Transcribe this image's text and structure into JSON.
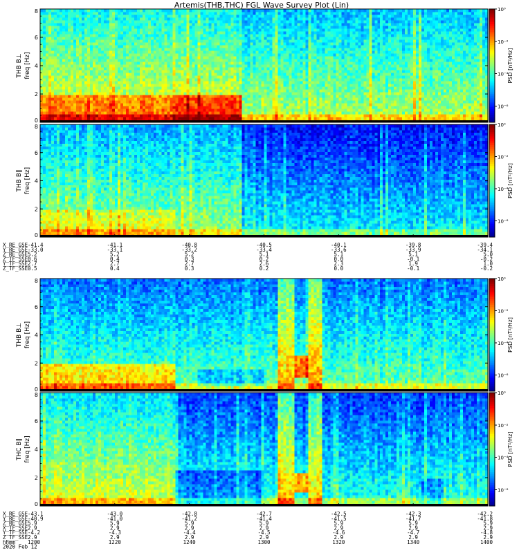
{
  "title": "Artemis(THB,THC) FGL Wave Survey Plot (Lin)",
  "chart_data": [
    {
      "type": "heatmap",
      "panel": "THB B⊥",
      "ylabel": "freq [Hz]",
      "label": "THB B⊥",
      "ylim": [
        0,
        8
      ],
      "yticks": [
        "0",
        "2",
        "4",
        "6",
        "8"
      ],
      "colorbar_label": "PSD [nT²/Hz]",
      "colorbar_ticks": [
        "10⁰",
        "10⁻²",
        "10⁻⁴",
        "10⁻⁶"
      ],
      "colorbar_top_exp": 0,
      "colorbar_bottom_exp": -7,
      "seed": 11,
      "base": -3.1,
      "features": [
        {
          "x0": 0.0,
          "x1": 0.3,
          "f0": 0,
          "f1": 2,
          "level": 1.6
        },
        {
          "x0": 0.3,
          "x1": 0.45,
          "f0": 0,
          "f1": 2,
          "level": 2.1
        },
        {
          "x0": 0.0,
          "x1": 0.45,
          "f0": 2,
          "f1": 8,
          "level": 0.5
        }
      ]
    },
    {
      "type": "heatmap",
      "panel": "THB B∥",
      "ylabel": "freq [Hz]",
      "label": "THB B∥",
      "ylim": [
        0,
        8
      ],
      "yticks": [
        "0",
        "2",
        "4",
        "6",
        "8"
      ],
      "colorbar_label": "PSD [nT²/Hz]",
      "colorbar_ticks": [
        "10⁰",
        "10⁻²",
        "10⁻⁴",
        "10⁻⁶"
      ],
      "colorbar_top_exp": 0,
      "colorbar_bottom_exp": -7,
      "seed": 23,
      "base": -4.3,
      "features": [
        {
          "x0": 0.0,
          "x1": 0.45,
          "f0": 0,
          "f1": 8,
          "level": 1.1
        },
        {
          "x0": 0.0,
          "x1": 0.3,
          "f0": 0,
          "f1": 2,
          "level": 0.6
        }
      ]
    },
    {
      "type": "heatmap",
      "panel": "THB B⊥",
      "ylabel": "freq [Hz]",
      "label": "THB B⊥",
      "ylim": [
        0,
        8
      ],
      "yticks": [
        "0",
        "2",
        "4",
        "6",
        "8"
      ],
      "colorbar_label": "PSD [nT²/Hz]",
      "colorbar_ticks": [
        "10⁰",
        "10⁻²",
        "10⁻⁴",
        "10⁻⁶"
      ],
      "colorbar_top_exp": 0,
      "colorbar_bottom_exp": -7,
      "seed": 37,
      "base": -3.6,
      "features": [
        {
          "x0": 0.0,
          "x1": 0.3,
          "f0": 0,
          "f1": 2,
          "level": 1.4
        },
        {
          "x0": 0.53,
          "x1": 0.57,
          "f0": 0,
          "f1": 8,
          "level": 1.6
        },
        {
          "x0": 0.57,
          "x1": 0.6,
          "f0": 1,
          "f1": 2.6,
          "level": 2.3
        },
        {
          "x0": 0.6,
          "x1": 0.63,
          "f0": 0,
          "f1": 8,
          "level": 1.6
        },
        {
          "x0": 0.35,
          "x1": 0.5,
          "f0": 0.3,
          "f1": 1.5,
          "level": -0.9
        }
      ]
    },
    {
      "type": "heatmap",
      "panel": "THC B∥",
      "ylabel": "freq [Hz]",
      "label": "THC B∥",
      "ylim": [
        0,
        8
      ],
      "yticks": [
        "0",
        "2",
        "4",
        "6",
        "8"
      ],
      "colorbar_label": "PSD [nT²/Hz]",
      "colorbar_ticks": [
        "10⁰",
        "10⁻²",
        "10⁻⁴",
        "10⁻⁶"
      ],
      "colorbar_top_exp": 0,
      "colorbar_bottom_exp": -7,
      "seed": 53,
      "base": -4.0,
      "features": [
        {
          "x0": 0.0,
          "x1": 0.3,
          "f0": 0,
          "f1": 8,
          "level": 1.2
        },
        {
          "x0": 0.53,
          "x1": 0.57,
          "f0": 0,
          "f1": 8,
          "level": 1.8
        },
        {
          "x0": 0.57,
          "x1": 0.6,
          "f0": 1,
          "f1": 2.4,
          "level": 2.3
        },
        {
          "x0": 0.6,
          "x1": 0.63,
          "f0": 0,
          "f1": 8,
          "level": 1.7
        },
        {
          "x0": 0.3,
          "x1": 0.5,
          "f0": 0,
          "f1": 2.5,
          "level": -1.0
        },
        {
          "x0": 0.85,
          "x1": 0.9,
          "f0": 0,
          "f1": 2,
          "level": -0.8
        }
      ]
    }
  ],
  "ephem_top": {
    "rows": [
      {
        "label": "X_RE_GSE",
        "values": [
          "-41.4",
          "-41.1",
          "-40.8",
          "-40.5",
          "-40.1",
          "-39.8",
          "-39.4"
        ]
      },
      {
        "label": "Y_RE_GSE",
        "values": [
          "-33.0",
          "-33.1",
          "-33.2",
          "-33.4",
          "-33.6",
          "-33.9",
          "-34.1"
        ]
      },
      {
        "label": "Z_RE_GSE",
        "values": [
          "5.2",
          "5.2",
          "5.2",
          "5.1",
          "5.1",
          "5.1",
          "5.0"
        ]
      },
      {
        "label": "Z_TF_SSE",
        "values": [
          "0.6",
          "0.4",
          "0.3",
          "0.2",
          "0.0",
          "-0.1",
          "-0.2"
        ]
      },
      {
        "label": "Y_TF_SSE",
        "values": [
          "2.7",
          "2.7",
          "2.7",
          "2.6",
          "2.3",
          "1.9",
          "1.0"
        ]
      },
      {
        "label": "Z_TF_SSE",
        "values": [
          "0.5",
          "0.4",
          "0.3",
          "0.2",
          "0.0",
          "-0.1",
          "-0.2"
        ]
      }
    ]
  },
  "ephem_bottom": {
    "rows": [
      {
        "label": "X_RE_GSE",
        "values": [
          "-43.1",
          "-43.0",
          "-42.8",
          "-42.7",
          "-42.5",
          "-42.3",
          "-42.2"
        ]
      },
      {
        "label": "Y_RE_GSE",
        "values": [
          "-40.9",
          "-41.0",
          "-41.2",
          "-41.4",
          "-41.5",
          "-41.7",
          "-41.8"
        ]
      },
      {
        "label": "Z_RE_GSE",
        "values": [
          "5.9",
          "5.9",
          "5.9",
          "5.9",
          "5.9",
          "5.9",
          "5.9"
        ]
      },
      {
        "label": "X_TF_SSE",
        "values": [
          "2.9",
          "2.9",
          "2.9",
          "2.9",
          "2.9",
          "2.9",
          "2.9"
        ]
      },
      {
        "label": "Y_TF_SSE",
        "values": [
          "-4.2",
          "-4.3",
          "-4.4",
          "-4.5",
          "-4.6",
          "-4.7",
          "-4.8"
        ]
      },
      {
        "label": "Z_TF_SSE",
        "values": [
          "2.9",
          "2.9",
          "2.9",
          "2.9",
          "2.9",
          "2.9",
          "2.9"
        ]
      },
      {
        "label": "hhmm",
        "values": [
          "1200",
          "1220",
          "1240",
          "1300",
          "1320",
          "1340",
          "1400"
        ]
      }
    ],
    "date": "2020 Feb 12"
  }
}
